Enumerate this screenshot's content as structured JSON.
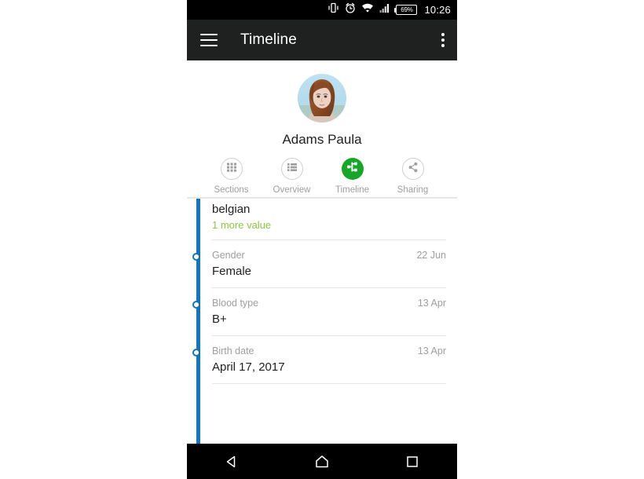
{
  "status_bar": {
    "icons": [
      "vibrate-icon",
      "alarm-icon",
      "wifi-icon",
      "signal-icon"
    ],
    "battery_percent": "69%",
    "time": "10:26"
  },
  "app_bar": {
    "menu_icon": "hamburger-menu-icon",
    "title": "Timeline",
    "overflow_icon": "overflow-menu-icon"
  },
  "profile": {
    "avatar_name": "user-avatar",
    "name": "Adams Paula"
  },
  "tabs": [
    {
      "label": "Sections",
      "icon": "grid-icon",
      "active": false
    },
    {
      "label": "Overview",
      "icon": "list-icon",
      "active": false
    },
    {
      "label": "Timeline",
      "icon": "timeline-branch-icon",
      "active": true
    },
    {
      "label": "Sharing",
      "icon": "share-icon",
      "active": false
    }
  ],
  "colors": {
    "accent_green": "#16a72a",
    "timeline_blue": "#1175c0",
    "more_value_green": "#8dc63f",
    "app_bar": "#1f2020"
  },
  "timeline": [
    {
      "label": "",
      "value": "belgian",
      "date": "",
      "more": "1 more value",
      "partial": true
    },
    {
      "label": "Gender",
      "value": "Female",
      "date": "22 Jun",
      "more": "",
      "partial": false
    },
    {
      "label": "Blood type",
      "value": "B+",
      "date": "13 Apr",
      "more": "",
      "partial": false
    },
    {
      "label": "Birth date",
      "value": "April 17, 2017",
      "date": "13 Apr",
      "more": "",
      "partial": false
    }
  ],
  "nav_bar": {
    "back": "back-icon",
    "home": "home-icon",
    "recents": "recents-icon"
  }
}
